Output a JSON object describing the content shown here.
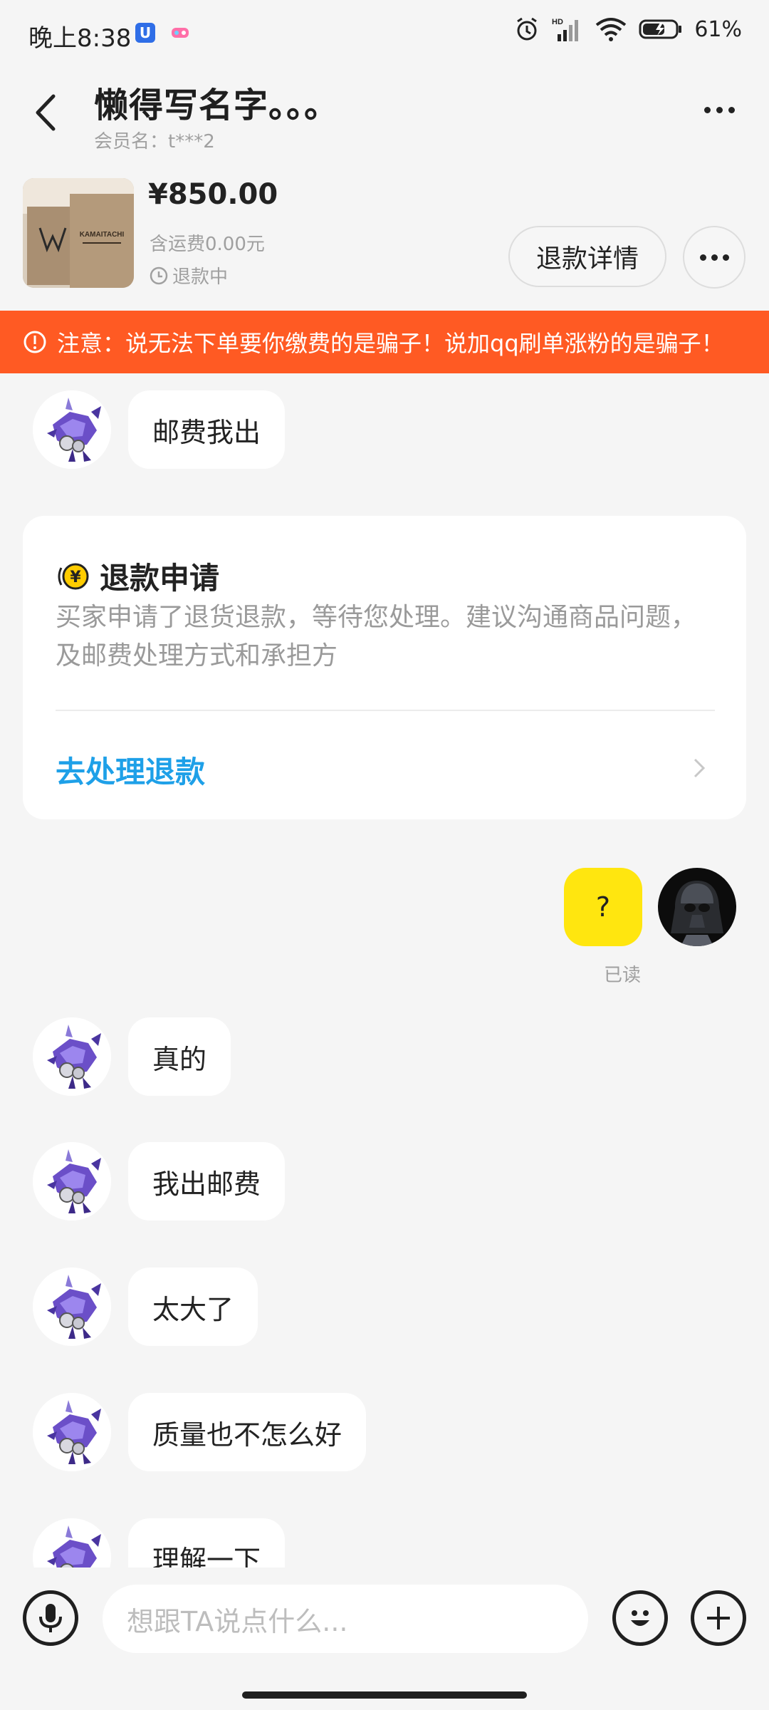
{
  "status_bar": {
    "time": "晚上8:38",
    "battery": "61%",
    "signal_label": "HD"
  },
  "header": {
    "title": "懒得写名字。。。",
    "member": "会员名：t***2"
  },
  "product": {
    "price": "¥850.00",
    "shipping": "含运费0.00元",
    "status": "退款中",
    "detail_button": "退款详情",
    "thumb_text": "KAMAITACHI"
  },
  "warning": "注意：说无法下单要你缴费的是骗子！说加qq刷单涨粉的是骗子！",
  "messages": [
    {
      "text": "邮费我出"
    },
    {
      "text": "真的"
    },
    {
      "text": "我出邮费"
    },
    {
      "text": "太大了"
    },
    {
      "text": "质量也不怎么好"
    },
    {
      "text": "理解一下"
    }
  ],
  "refund_card": {
    "title": "退款申请",
    "description": "买家申请了退货退款，等待您处理。建议沟通商品问题，及邮费处理方式和承担方",
    "action": "去处理退款",
    "icon_glyph": "¥"
  },
  "my_message": {
    "text": "?",
    "status": "已读"
  },
  "input": {
    "placeholder": "想跟TA说点什么..."
  },
  "colors": {
    "warning_bg": "#ff5a23",
    "my_bubble": "#ffe60f",
    "link": "#1ea0e8"
  }
}
